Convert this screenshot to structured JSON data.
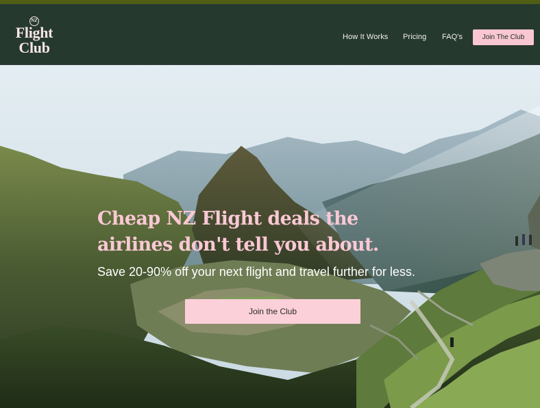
{
  "brand": {
    "badge": "NZ",
    "name_line1": "Flight",
    "name_line2": "Club"
  },
  "nav": {
    "items": [
      {
        "label": "How It Works"
      },
      {
        "label": "Pricing"
      },
      {
        "label": "FAQ's"
      }
    ],
    "cta_label": "Join The Club"
  },
  "hero": {
    "headline_line1": "Cheap NZ Flight deals the",
    "headline_line2": "airlines don't tell you about.",
    "subheadline": "Save 20-90% off your next flight and travel further for less.",
    "cta_label": "Join the Club",
    "image": "mountain-ruins-photo"
  },
  "colors": {
    "header_bg": "#26392f",
    "top_strip": "#4f5d15",
    "accent_pink": "#f8c7d2",
    "headline_pink": "#fac8d4"
  }
}
